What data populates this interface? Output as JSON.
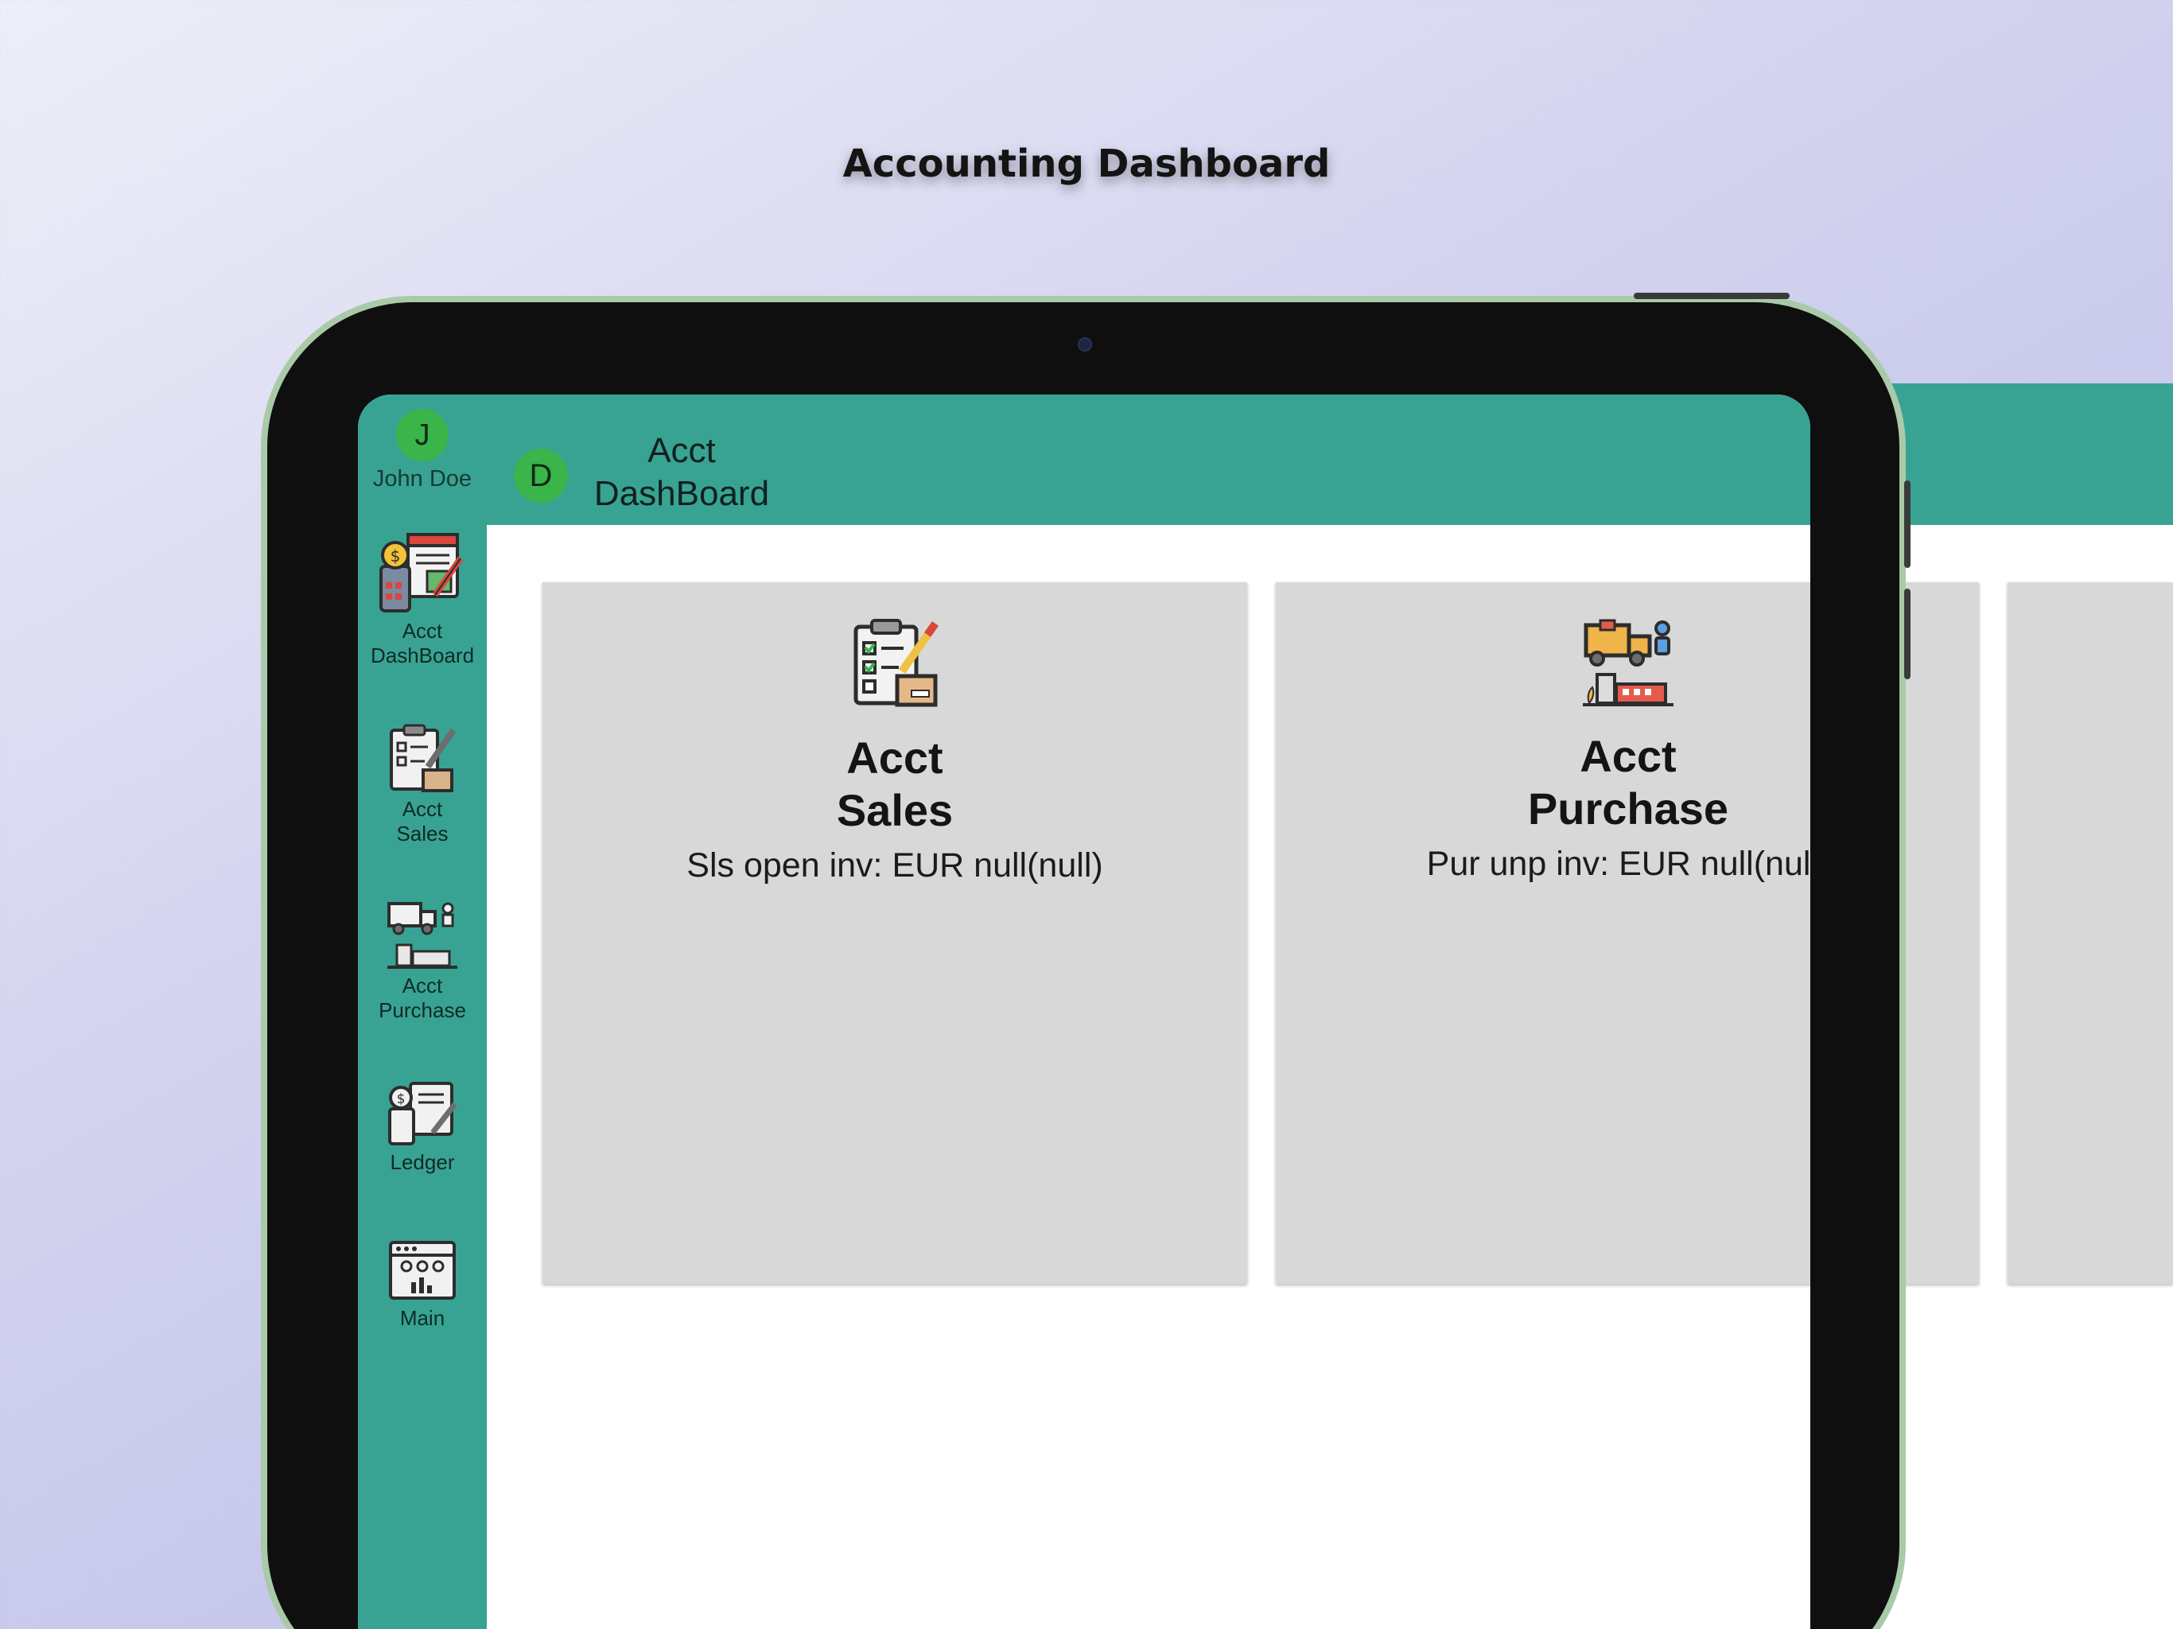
{
  "marketing": {
    "title": "Accounting Dashboard"
  },
  "user": {
    "initial": "J",
    "name": "John Doe"
  },
  "header": {
    "initial": "D",
    "title_line1": "Acct",
    "title_line2": "DashBoard"
  },
  "sidebar": {
    "items": [
      {
        "line1": "Acct",
        "line2": "DashBoard",
        "icon": "accounting-dashboard-icon"
      },
      {
        "line1": "Acct",
        "line2": "Sales",
        "icon": "sales-clipboard-icon"
      },
      {
        "line1": "Acct",
        "line2": "Purchase",
        "icon": "purchase-truck-icon"
      },
      {
        "line1": "Ledger",
        "line2": "",
        "icon": "ledger-icon"
      },
      {
        "line1": "Main",
        "line2": "",
        "icon": "main-dashboard-icon"
      }
    ]
  },
  "cards": [
    {
      "title_line1": "Acct",
      "title_line2": "Sales",
      "subtitle": "Sls open inv: EUR null(null)",
      "icon": "sales-clipboard-icon"
    },
    {
      "title_line1": "Acct",
      "title_line2": "Purchase",
      "subtitle": "Pur unp inv: EUR null(null)",
      "icon": "purchase-truck-icon"
    }
  ],
  "colors": {
    "teal": "#38a393",
    "avatar_green": "#39b54a",
    "card_gray": "#d8d8d8",
    "device_frame": "#a9caa8"
  }
}
